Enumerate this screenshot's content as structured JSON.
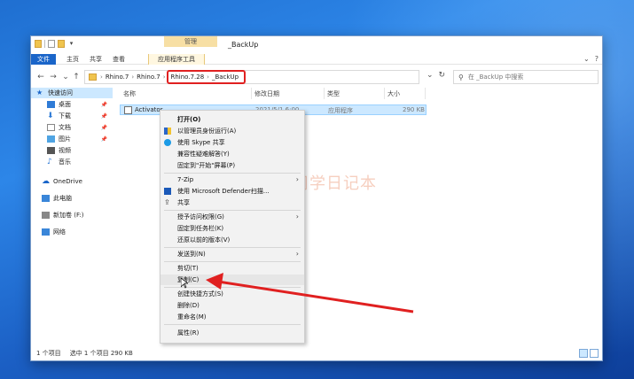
{
  "window": {
    "title": "_BackUp",
    "context_tab_head": "管理",
    "ribbon_tabs": [
      "文件",
      "主页",
      "共享",
      "查看",
      "应用程序工具"
    ]
  },
  "address": {
    "crumbs": [
      "Rhino.7",
      "Rhino.7"
    ],
    "highlighted_crumbs": [
      "Rhino.7.28",
      "_BackUp"
    ],
    "search_placeholder": "在 _BackUp 中搜索"
  },
  "sidebar": {
    "items": [
      {
        "label": "快速访问",
        "icon": "star-icon",
        "pinned": false
      },
      {
        "label": "桌面",
        "icon": "desktop-icon",
        "pinned": true
      },
      {
        "label": "下载",
        "icon": "download-icon",
        "pinned": true
      },
      {
        "label": "文档",
        "icon": "document-icon",
        "pinned": true
      },
      {
        "label": "图片",
        "icon": "picture-icon",
        "pinned": true
      },
      {
        "label": "视频",
        "icon": "video-icon",
        "pinned": false
      },
      {
        "label": "音乐",
        "icon": "music-icon",
        "pinned": false
      },
      {
        "label": "OneDrive",
        "icon": "cloud-icon",
        "pinned": false
      },
      {
        "label": "此电脑",
        "icon": "computer-icon",
        "pinned": false
      },
      {
        "label": "新加卷 (F:)",
        "icon": "drive-icon",
        "pinned": false
      },
      {
        "label": "网络",
        "icon": "network-icon",
        "pinned": false
      }
    ]
  },
  "list": {
    "columns": [
      "名称",
      "修改日期",
      "类型",
      "大小"
    ],
    "rows": [
      {
        "name": "Activator",
        "date": "2021/5/1 6:00",
        "type": "应用程序",
        "size": "290 KB"
      }
    ]
  },
  "status": {
    "count": "1 个项目",
    "selected": "选中 1 个项目  290 KB"
  },
  "context_menu": {
    "items": [
      {
        "label": "打开(O)",
        "bold": true
      },
      {
        "label": "以管理员身份运行(A)",
        "icon": "shield-icon"
      },
      {
        "label": "使用 Skype 共享",
        "icon": "skype-icon"
      },
      {
        "label": "兼容性疑难解答(Y)"
      },
      {
        "label": "固定到\"开始\"屏幕(P)"
      },
      {
        "label": "7-Zip",
        "submenu": true
      },
      {
        "label": "使用 Microsoft Defender扫描...",
        "icon": "defender-icon"
      },
      {
        "label": "共享",
        "icon": "share-icon"
      },
      {
        "label": "授予访问权限(G)",
        "submenu": true
      },
      {
        "label": "固定到任务栏(K)"
      },
      {
        "label": "还原以前的版本(V)"
      },
      {
        "label": "发送到(N)",
        "submenu": true
      },
      {
        "label": "剪切(T)"
      },
      {
        "label": "复制(C)"
      },
      {
        "label": "创建快捷方式(S)"
      },
      {
        "label": "删除(D)"
      },
      {
        "label": "重命名(M)"
      },
      {
        "label": "属性(R)"
      }
    ]
  },
  "watermark": {
    "text": "丁司学日记本"
  },
  "colors": {
    "accent": "#1a65c9",
    "highlight": "#e02020",
    "selection": "#cce8ff"
  }
}
